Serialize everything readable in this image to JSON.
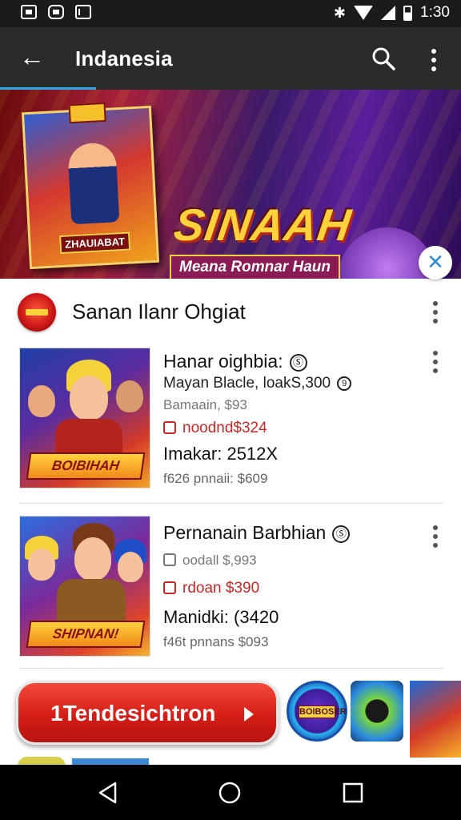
{
  "status_bar": {
    "time": "1:30",
    "icons": [
      "notification-icon",
      "android-icon",
      "mail-icon",
      "bluetooth-icon",
      "wifi-icon",
      "signal-icon",
      "battery-icon"
    ]
  },
  "app_bar": {
    "title": "Indanesia",
    "icons": [
      "back-arrow-icon",
      "search-icon",
      "more-vert-icon"
    ]
  },
  "banner": {
    "title": "SINAAH",
    "subtitle": "Meana Romnar Haun",
    "box_tag": "ZHAUIABAT",
    "page_count": 4,
    "active_page": 1
  },
  "section": {
    "name": "Sanan Ilanr Ohgiat"
  },
  "items": [
    {
      "title": "Hanar oighbia:",
      "subtitle": "Mayan Blacle, loakS,300",
      "meta": "Bamaain, $93",
      "price": "noodnd$324",
      "stat": "Imakar: 2512X",
      "meta2": "f626 pnnaii: $609",
      "art_label": "BOIBIHAH"
    },
    {
      "title": "Pernanain Barbhian",
      "meta": "oodall $,993",
      "price": "rdoan $390",
      "stat": "Manidki: (3420",
      "meta2": "f46t pnnans $093",
      "art_label": "SHIPNAN!"
    }
  ],
  "cta": {
    "label": "1Tendesichtron"
  },
  "round_icon_label": "BOIBOSER",
  "colors": {
    "app_bar": "#2a2a2a",
    "accent": "#2aa8e8",
    "cta_red": "#d51d17",
    "price_red": "#c62828"
  }
}
